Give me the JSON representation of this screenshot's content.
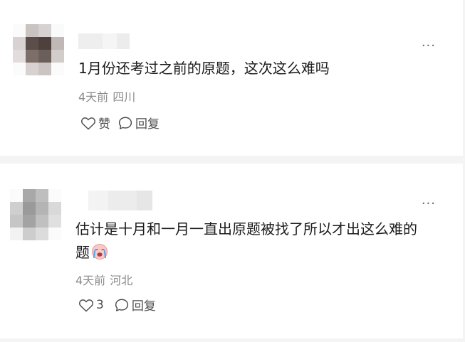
{
  "comments": [
    {
      "text": "1月份还考过之前的原题，这次这么难吗",
      "time": "4天前",
      "location": "四川",
      "like_label": "赞",
      "reply_label": "回复",
      "more_label": "···",
      "icons": {
        "like": "heart-outline-icon",
        "reply": "speech-bubble-icon",
        "more": "more-dots-icon"
      }
    },
    {
      "text_line1": "估计是十月和一月一直出原题被找了所以才出这么难的",
      "text_line2": "题",
      "emoji": "crying-face-emoji",
      "time": "4天前",
      "location": "河北",
      "like_count": "3",
      "reply_label": "回复",
      "more_label": "···",
      "icons": {
        "like": "heart-outline-icon",
        "reply": "speech-bubble-icon",
        "more": "more-dots-icon"
      }
    }
  ],
  "colors": {
    "page_background": "#f4f4f5",
    "card_background": "#ffffff",
    "text": "#1b1b1b",
    "meta_text": "#8b8b8b",
    "action_text": "#4d4d4d"
  }
}
